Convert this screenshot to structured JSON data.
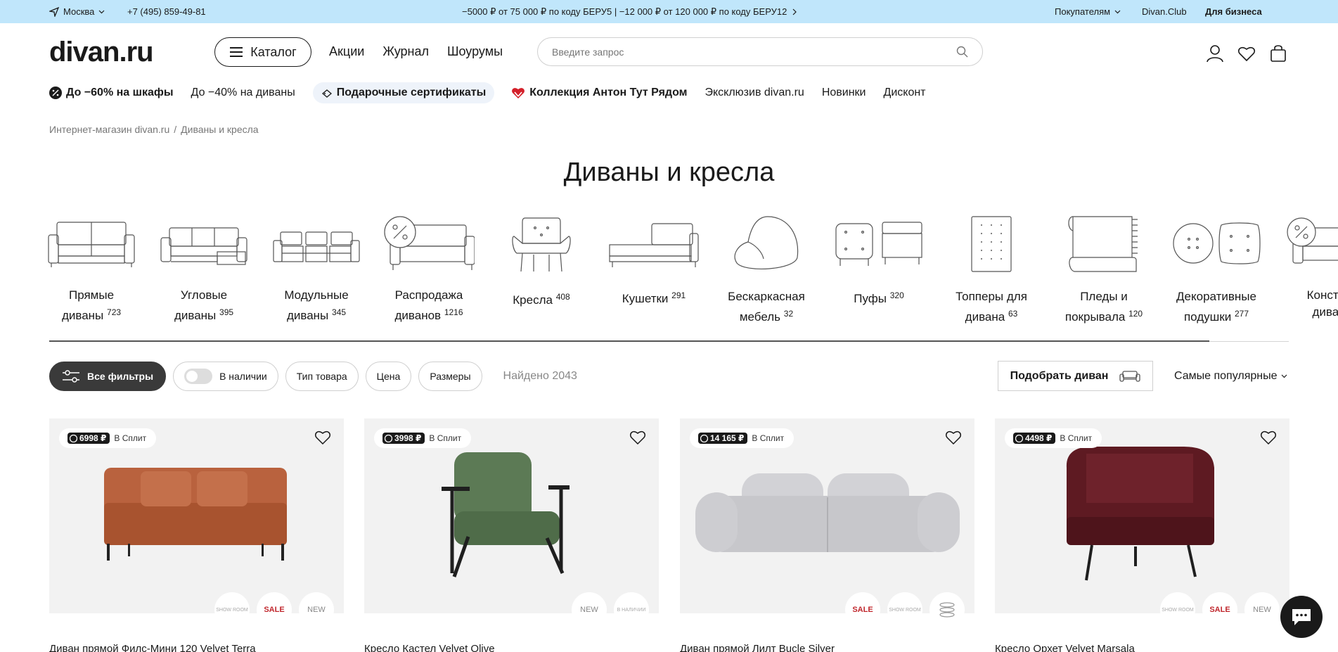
{
  "topbar": {
    "city": "Москва",
    "phone": "+7 (495) 859-49-81",
    "promo": "−5000 ₽ от 75 000 ₽ по коду БЕРУ5 | −12 000 ₽ от 120 000 ₽ по коду БЕРУ12",
    "buyers": "Покупателям",
    "club": "Divan.Club",
    "business": "Для бизнеса"
  },
  "header": {
    "logo": "divan.ru",
    "catalog": "Каталог",
    "nav": [
      "Акции",
      "Журнал",
      "Шоурумы"
    ],
    "search_placeholder": "Введите запрос"
  },
  "promos": {
    "wardrobes": "До −60% на шкафы",
    "sofas": "До −40% на диваны",
    "gift": "Подарочные сертификаты",
    "collection": "Коллекция Антон Тут Рядом",
    "exclusive": "Эксклюзив divan.ru",
    "new": "Новинки",
    "discount": "Дисконт"
  },
  "breadcrumb": {
    "home": "Интернет-магазин divan.ru",
    "sep": "/",
    "current": "Диваны и кресла"
  },
  "page_title": "Диваны и кресла",
  "categories": [
    {
      "l1": "Прямые",
      "l2": "диваны",
      "count": "723"
    },
    {
      "l1": "Угловые",
      "l2": "диваны",
      "count": "395"
    },
    {
      "l1": "Модульные",
      "l2": "диваны",
      "count": "345"
    },
    {
      "l1": "Распродажа",
      "l2": "диванов",
      "count": "1216"
    },
    {
      "l1": "",
      "l2": "Кресла",
      "count": "408"
    },
    {
      "l1": "",
      "l2": "Кушетки",
      "count": "291"
    },
    {
      "l1": "Бескаркасная",
      "l2": "мебель",
      "count": "32"
    },
    {
      "l1": "",
      "l2": "Пуфы",
      "count": "320"
    },
    {
      "l1": "Топперы для",
      "l2": "дивана",
      "count": "63"
    },
    {
      "l1": "Пледы и",
      "l2": "покрывала",
      "count": "120"
    },
    {
      "l1": "Декоративные",
      "l2": "подушки",
      "count": "277"
    },
    {
      "l1": "Констру",
      "l2": "диван",
      "count": ""
    }
  ],
  "filters": {
    "all": "Все фильтры",
    "in_stock": "В наличии",
    "type": "Тип товара",
    "price": "Цена",
    "sizes": "Размеры",
    "found": "Найдено 2043",
    "pick_sofa": "Подобрать диван",
    "sort": "Самые популярные"
  },
  "products": [
    {
      "split_price": "6998 ₽",
      "split_label": "В Сплит",
      "name": "Диван прямой Филс-Мини 120 Velvet Terra",
      "color": "#b9623e"
    },
    {
      "split_price": "3998 ₽",
      "split_label": "В Сплит",
      "name": "Кресло Кастел Velvet Olive",
      "color": "#5c7a55"
    },
    {
      "split_price": "14 165 ₽",
      "split_label": "В Сплит",
      "name": "Диван прямой Лилт Bucle Silver",
      "color": "#c9c9cc"
    },
    {
      "split_price": "4498 ₽",
      "split_label": "В Сплит",
      "name": "Кресло Орхет Velvet Marsala",
      "color": "#5e1a22"
    }
  ],
  "badges": {
    "showroom": "SHOW ROOM",
    "sale": "SALE",
    "new": "NEW",
    "in_stock": "В НАЛИЧИИ"
  }
}
